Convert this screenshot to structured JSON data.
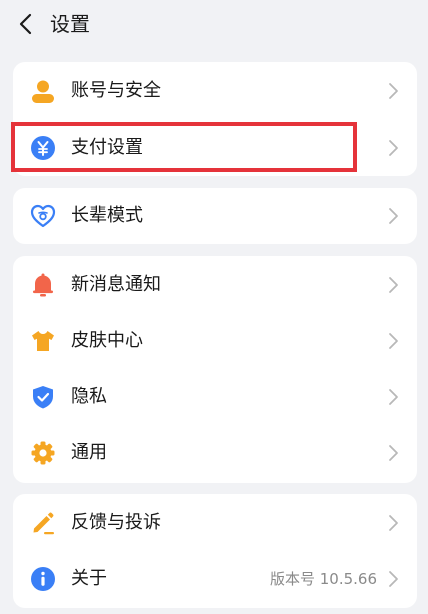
{
  "header": {
    "title": "设置",
    "back_icon": "chevron-left-icon"
  },
  "groups": [
    {
      "items": [
        {
          "label": "账号与安全",
          "icon": "user-icon",
          "icon_color": "#f5a623"
        },
        {
          "label": "支付设置",
          "icon": "yuan-icon",
          "icon_color": "#3a7ff6",
          "highlighted": true
        }
      ]
    },
    {
      "items": [
        {
          "label": "长辈模式",
          "icon": "heart-elder-icon",
          "icon_color": "#3a7ff6"
        }
      ]
    },
    {
      "items": [
        {
          "label": "新消息通知",
          "icon": "bell-icon",
          "icon_color": "#f2654a"
        },
        {
          "label": "皮肤中心",
          "icon": "tshirt-icon",
          "icon_color": "#f5a623"
        },
        {
          "label": "隐私",
          "icon": "shield-check-icon",
          "icon_color": "#3a7ff6"
        },
        {
          "label": "通用",
          "icon": "gear-icon",
          "icon_color": "#f5a623"
        }
      ]
    },
    {
      "items": [
        {
          "label": "反馈与投诉",
          "icon": "pencil-icon",
          "icon_color": "#f5a623"
        },
        {
          "label": "关于",
          "icon": "info-icon",
          "icon_color": "#3a7ff6",
          "extra": "版本号 10.5.66"
        }
      ]
    }
  ],
  "colors": {
    "background": "#f1f2f5",
    "card": "#ffffff",
    "highlight_border": "#e5333a",
    "chevron": "#b8b8b8"
  }
}
